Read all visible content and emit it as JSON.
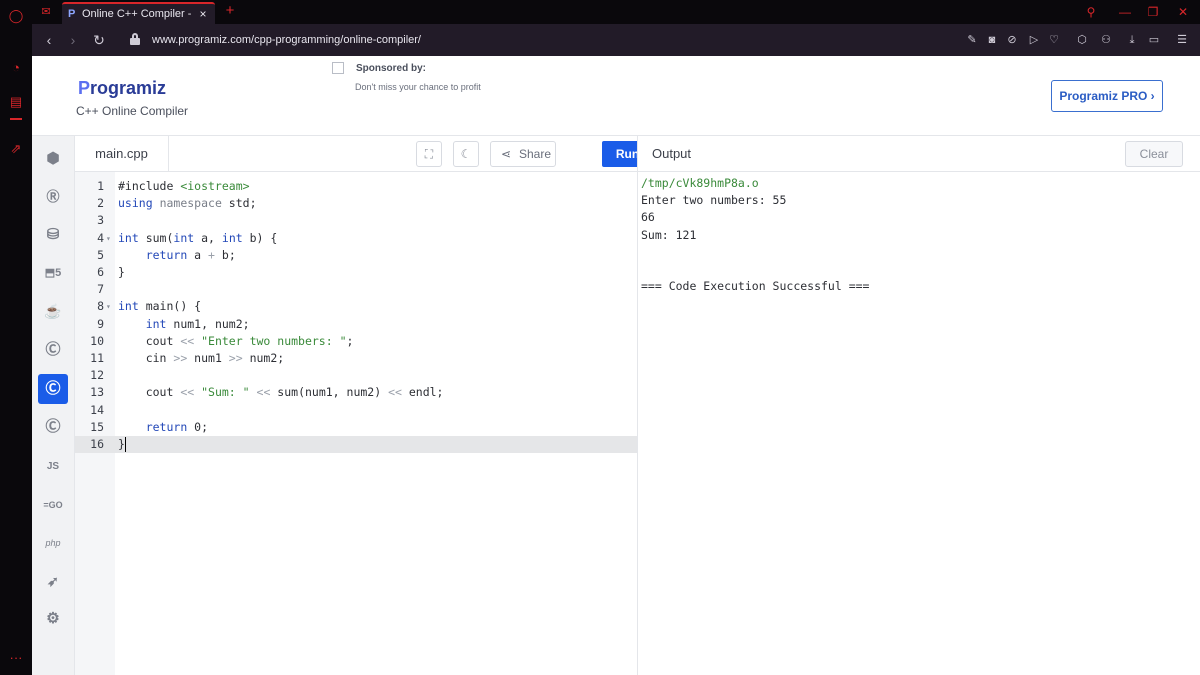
{
  "browser": {
    "tab_title": "Online C++ Compiler - Pro",
    "tab_favicon": "P",
    "tab_close": "×",
    "new_tab": "+",
    "url": "www.programiz.com/cpp-programming/online-compiler/",
    "accent_color": "#d8262a"
  },
  "header": {
    "logo_initial": "P",
    "logo_rest": "rogramiz",
    "subtitle": "C++ Online Compiler",
    "sponsor_title": "Sponsored by:",
    "sponsor_text": "Don't miss your chance to profit",
    "pro_button": "Programiz PRO ›"
  },
  "languages": [
    "python",
    "r",
    "sql",
    "html",
    "java",
    "c",
    "cpp",
    "csharp",
    "js",
    "go",
    "php",
    "swift",
    "rust"
  ],
  "languages_active": "cpp",
  "editor": {
    "file_name": "main.cpp",
    "share_label": "Share",
    "run_label": "Run",
    "lines": [
      {
        "n": "1",
        "code": "#include <iostream>"
      },
      {
        "n": "2",
        "code": "using namespace std;"
      },
      {
        "n": "3",
        "code": ""
      },
      {
        "n": "4",
        "code": "int sum(int a, int b) {"
      },
      {
        "n": "5",
        "code": "    return a + b;"
      },
      {
        "n": "6",
        "code": "}"
      },
      {
        "n": "7",
        "code": ""
      },
      {
        "n": "8",
        "code": "int main() {"
      },
      {
        "n": "9",
        "code": "    int num1, num2;"
      },
      {
        "n": "10",
        "code": "    cout << \"Enter two numbers: \";"
      },
      {
        "n": "11",
        "code": "    cin >> num1 >> num2;"
      },
      {
        "n": "12",
        "code": ""
      },
      {
        "n": "13",
        "code": "    cout << \"Sum: \" << sum(num1, num2) << endl;"
      },
      {
        "n": "14",
        "code": ""
      },
      {
        "n": "15",
        "code": "    return 0;"
      },
      {
        "n": "16",
        "code": "}"
      }
    ],
    "current_line": "16"
  },
  "output": {
    "title": "Output",
    "clear_label": "Clear",
    "lines": [
      "/tmp/cVk89hmP8a.o",
      "Enter two numbers: 55",
      "66",
      "Sum: 121",
      "",
      "",
      "=== Code Execution Successful ==="
    ]
  }
}
